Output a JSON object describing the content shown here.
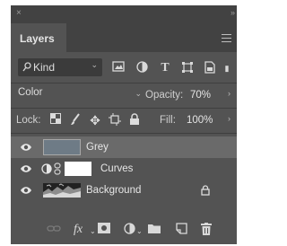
{
  "panel": {
    "close_glyph": "×",
    "collapse_glyph": "»",
    "tab_label": "Layers",
    "menu_icon": "hamburger-menu-icon"
  },
  "filter": {
    "kind_label": "Kind",
    "icons": [
      "pixel-filter-icon",
      "adjustment-filter-icon",
      "type-filter-icon",
      "shape-filter-icon",
      "smart-object-filter-icon"
    ]
  },
  "blend": {
    "mode": "Color",
    "opacity_label": "Opacity:",
    "opacity_value": "70%"
  },
  "lock": {
    "label": "Lock:",
    "icons": [
      "lock-transparent-pixels-icon",
      "lock-image-pixels-icon",
      "lock-position-icon",
      "lock-artboard-icon",
      "lock-all-icon"
    ],
    "fill_label": "Fill:",
    "fill_value": "100%"
  },
  "layers": [
    {
      "name": "Grey",
      "type": "pixel",
      "selected": true,
      "visible": true,
      "thumbnail_color": "#6e7b86"
    },
    {
      "name": "Curves",
      "type": "adjustment",
      "selected": false,
      "visible": true,
      "thumbnail_color": "#ffffff"
    },
    {
      "name": "Background",
      "type": "background",
      "selected": false,
      "visible": true,
      "locked": true
    }
  ],
  "bottom_icons": [
    "link-layers-icon",
    "fx-icon",
    "add-mask-icon",
    "new-adjustment-layer-icon",
    "new-group-icon",
    "new-layer-icon",
    "delete-layer-icon"
  ],
  "colors": {
    "panel_bg": "#535353",
    "tab_strip_bg": "#424242",
    "selected_row_bg": "#6a6a6a"
  }
}
